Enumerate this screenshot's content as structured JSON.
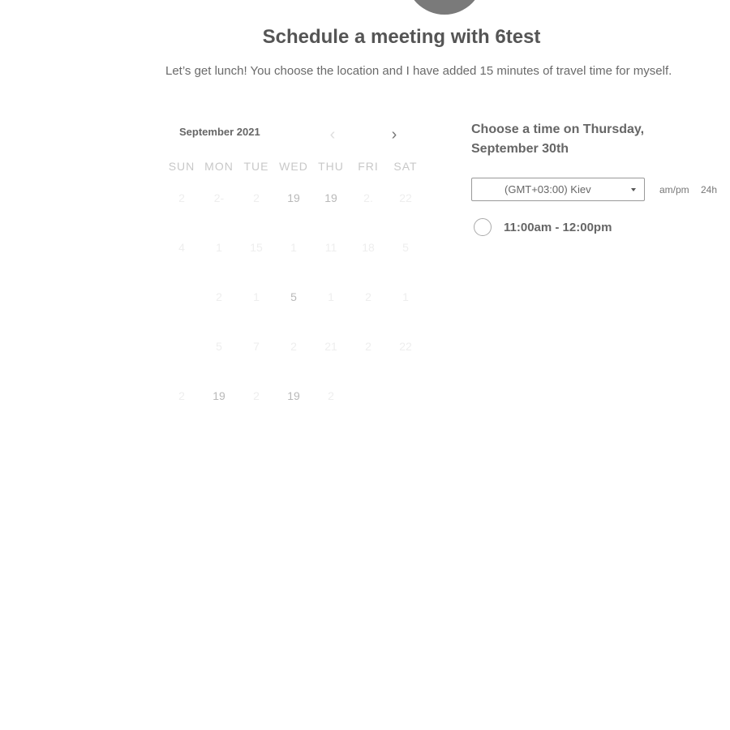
{
  "header": {
    "title": "Schedule a meeting with 6test",
    "subtitle": "Let’s get lunch! You choose the location and I have added 15 minutes of travel time for myself."
  },
  "calendar": {
    "month_label": "September 2021",
    "prev_icon": "chevron-left-icon",
    "next_icon": "chevron-right-icon",
    "weekdays": [
      "SUN",
      "MON",
      "TUE",
      "WED",
      "THU",
      "FRI",
      "SAT"
    ],
    "weeks": [
      [
        {
          "d": "2",
          "a": false
        },
        {
          "d": "2-",
          "a": false
        },
        {
          "d": "2",
          "a": false
        },
        {
          "d": "19",
          "a": true
        },
        {
          "d": "19",
          "a": true
        },
        {
          "d": "2.",
          "a": false
        },
        {
          "d": "22",
          "a": false
        }
      ],
      [
        {
          "d": "4",
          "a": false
        },
        {
          "d": "1",
          "a": false
        },
        {
          "d": "15",
          "a": false
        },
        {
          "d": "1",
          "a": false
        },
        {
          "d": "11",
          "a": false
        },
        {
          "d": "18",
          "a": false
        },
        {
          "d": "5",
          "a": false
        }
      ],
      [
        {
          "d": "",
          "a": false
        },
        {
          "d": "2",
          "a": false
        },
        {
          "d": "1",
          "a": false
        },
        {
          "d": "5",
          "a": true
        },
        {
          "d": "1",
          "a": false
        },
        {
          "d": "2",
          "a": false
        },
        {
          "d": "1",
          "a": false
        }
      ],
      [
        {
          "d": "",
          "a": false
        },
        {
          "d": "5",
          "a": false
        },
        {
          "d": "7",
          "a": false
        },
        {
          "d": "2",
          "a": false
        },
        {
          "d": "21",
          "a": false
        },
        {
          "d": "2",
          "a": false
        },
        {
          "d": "22",
          "a": false
        }
      ],
      [
        {
          "d": "2",
          "a": false
        },
        {
          "d": "19",
          "a": true
        },
        {
          "d": "2",
          "a": false
        },
        {
          "d": "19",
          "a": true
        },
        {
          "d": "2",
          "a": false
        },
        {
          "d": "",
          "a": false
        },
        {
          "d": "",
          "a": false
        }
      ]
    ]
  },
  "time_panel": {
    "heading": "Choose a time on Thursday, September 30th",
    "timezone": "(GMT+03:00) Kiev",
    "format_ampm": "am/pm",
    "format_24h": "24h",
    "slots": [
      {
        "label": "11:00am - 12:00pm"
      }
    ]
  }
}
